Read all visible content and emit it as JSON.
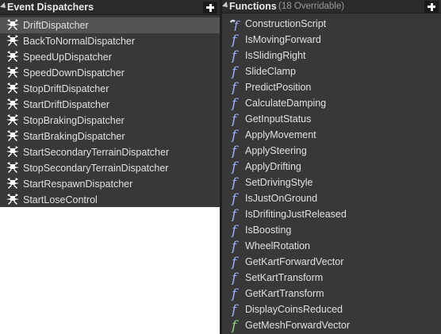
{
  "event_dispatchers": {
    "title": "Event Dispatchers",
    "add_icon": "plus-icon",
    "items": [
      {
        "label": "DriftDispatcher",
        "selected": true
      },
      {
        "label": "BackToNormalDispatcher"
      },
      {
        "label": "SpeedUpDispatcher"
      },
      {
        "label": "SpeedDownDispatcher"
      },
      {
        "label": "StopDriftDispatcher"
      },
      {
        "label": "StartDriftDispatcher"
      },
      {
        "label": "StopBrakingDispatcher"
      },
      {
        "label": "StartBrakingDispatcher"
      },
      {
        "label": "StartSecondaryTerrainDispatcher"
      },
      {
        "label": "StopSecondaryTerrainDispatcher"
      },
      {
        "label": "StartRespawnDispatcher"
      },
      {
        "label": "StartLoseControl"
      }
    ]
  },
  "functions": {
    "title": "Functions",
    "subtitle": "(18 Overridable)",
    "add_icon": "plus-icon",
    "items": [
      {
        "label": "ConstructionScript",
        "icon": "construction-script-icon"
      },
      {
        "label": "IsMovingForward",
        "icon": "function-icon"
      },
      {
        "label": "IsSlidingRight",
        "icon": "function-icon"
      },
      {
        "label": "SlideClamp",
        "icon": "function-icon"
      },
      {
        "label": "PredictPosition",
        "icon": "function-icon"
      },
      {
        "label": "CalculateDamping",
        "icon": "function-icon"
      },
      {
        "label": "GetInputStatus",
        "icon": "function-icon"
      },
      {
        "label": "ApplyMovement",
        "icon": "function-icon"
      },
      {
        "label": "ApplySteering",
        "icon": "function-icon"
      },
      {
        "label": "ApplyDrifting",
        "icon": "function-icon"
      },
      {
        "label": "SetDrivingStyle",
        "icon": "function-icon"
      },
      {
        "label": "IsJustOnGround",
        "icon": "function-icon"
      },
      {
        "label": "IsDrifitingJustReleased",
        "icon": "function-icon"
      },
      {
        "label": "IsBoosting",
        "icon": "function-icon"
      },
      {
        "label": "WheelRotation",
        "icon": "function-icon"
      },
      {
        "label": "GetKartForwardVector",
        "icon": "function-icon"
      },
      {
        "label": "SetKartTransform",
        "icon": "function-icon"
      },
      {
        "label": "GetKartTransform",
        "icon": "function-icon"
      },
      {
        "label": "DisplayCoinsReduced",
        "icon": "function-icon"
      },
      {
        "label": "GetMeshForwardVector",
        "icon": "pure-function-icon"
      }
    ]
  },
  "colors": {
    "panel_bg": "#383838",
    "header_bg": "#2b2b2b",
    "selected_row": "#545454",
    "function_icon": "#9fb1ff",
    "pure_function_icon": "#8fd67a",
    "dispatcher_icon": "#ffffff"
  }
}
